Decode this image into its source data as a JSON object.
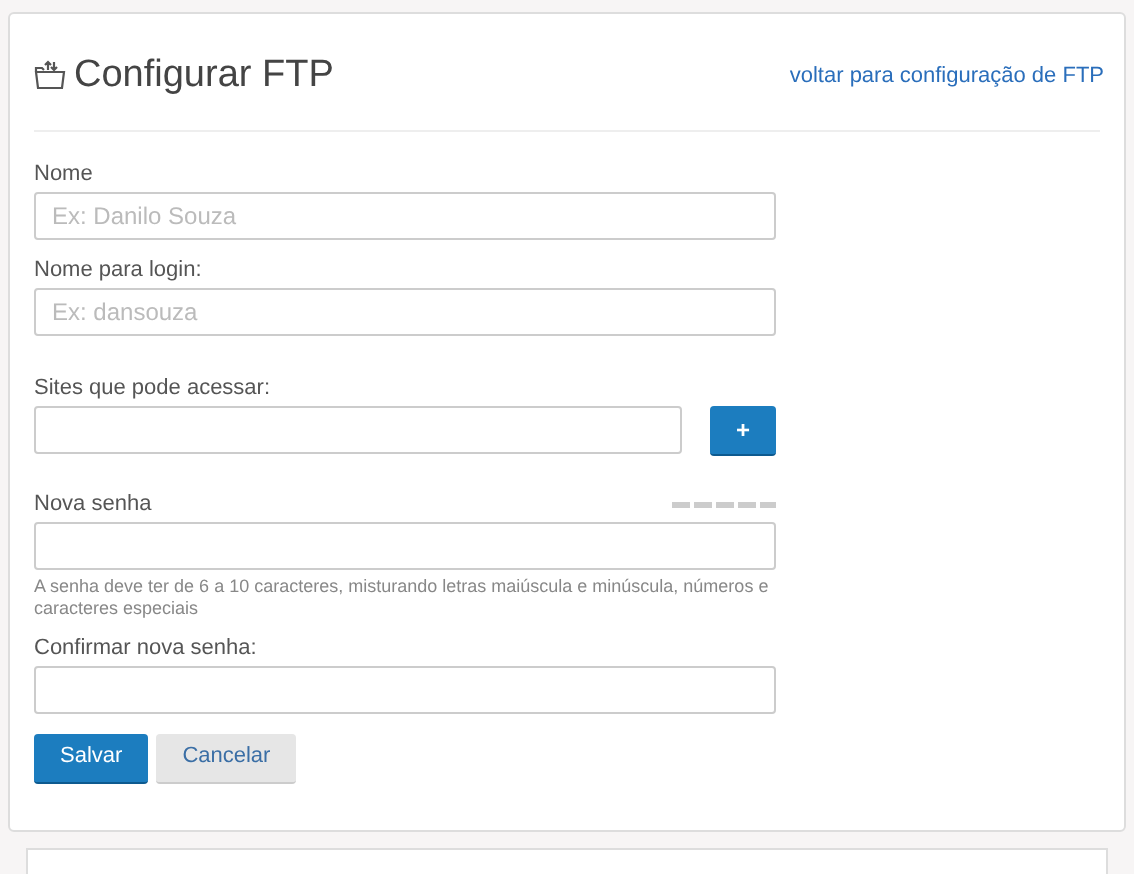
{
  "header": {
    "title": "Configurar FTP",
    "back_link": "voltar para configuração de FTP"
  },
  "fields": [
    {
      "kind": "text",
      "label": "Nome",
      "placeholder": "Ex: Danilo Souza"
    },
    {
      "kind": "text",
      "label": "Nome para login:",
      "placeholder": "Ex: dansouza"
    },
    {
      "kind": "add",
      "label": "Sites que pode acessar:",
      "button": "+"
    },
    {
      "kind": "password",
      "label": "Nova senha",
      "hint": "A senha deve ter de 6 a 10 caracteres, misturando letras maiúscula e minúscula, números e caracteres especiais"
    },
    {
      "kind": "text",
      "label": "Confirmar nova senha:"
    }
  ],
  "buttons": [
    {
      "label": "Salvar",
      "kind": "primary"
    },
    {
      "label": "Cancelar",
      "kind": "secondary"
    }
  ]
}
